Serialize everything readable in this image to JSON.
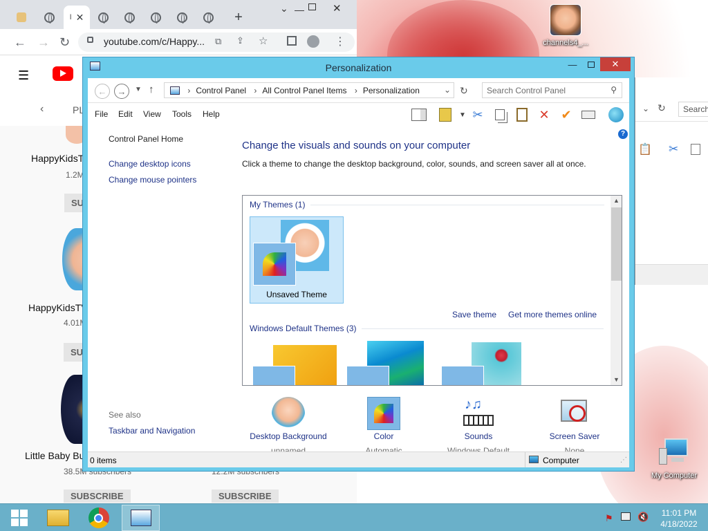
{
  "desktop": {
    "icons": [
      {
        "label": "channels4_...",
        "icon": "baby-photo-icon"
      },
      {
        "label": "My Computer",
        "icon": "computer-icon"
      }
    ]
  },
  "browser": {
    "url": "youtube.com/c/Happy...",
    "nav_label": "PL",
    "channels": [
      {
        "name": "HappyKidsT",
        "subs": "1.2M",
        "subscribe": "SU"
      },
      {
        "name": "HappyKidsTV",
        "subs": "4.01M",
        "subscribe": "SU"
      },
      {
        "name": "Little Baby Bu",
        "subs": "38.5M subscribers",
        "subscribe": "SUBSCRIBE"
      },
      {
        "name": "",
        "subs": "12.2M subscribers",
        "subscribe": "SUBSCRIBE"
      }
    ]
  },
  "explorer_behind": {
    "search_placeholder": "Search"
  },
  "window": {
    "title": "Personalization",
    "address": {
      "crumbs": [
        "Control Panel",
        "All Control Panel Items",
        "Personalization"
      ],
      "search_placeholder": "Search Control Panel"
    },
    "menu": [
      "File",
      "Edit",
      "View",
      "Tools",
      "Help"
    ],
    "left_nav": {
      "home": "Control Panel Home",
      "links": [
        "Change desktop icons",
        "Change mouse pointers"
      ],
      "see_also_title": "See also",
      "see_also_links": [
        "Taskbar and Navigation"
      ]
    },
    "main": {
      "heading": "Change the visuals and sounds on your computer",
      "description": "Click a theme to change the desktop background, color, sounds, and screen saver all at once.",
      "my_themes_title": "My Themes (1)",
      "unsaved_theme_label": "Unsaved Theme",
      "save_theme": "Save theme",
      "get_more_themes": "Get more themes online",
      "default_themes_title": "Windows Default Themes (3)"
    },
    "bottom_items": [
      {
        "label": "Desktop Background",
        "value": "unnamed",
        "icon": "baby-wallpaper-icon"
      },
      {
        "label": "Color",
        "value": "Automatic",
        "icon": "color-fan-icon"
      },
      {
        "label": "Sounds",
        "value": "Windows Default",
        "icon": "music-keyboard-icon"
      },
      {
        "label": "Screen Saver",
        "value": "None",
        "icon": "screen-saver-icon"
      }
    ],
    "status": {
      "items": "0 items",
      "location": "Computer"
    }
  },
  "taskbar": {
    "time": "11:01 PM",
    "date": "4/18/2022"
  },
  "colors": {
    "titlebar": "#6acbea",
    "link": "#1e3287",
    "close": "#c7403a",
    "taskbar": "#6ab0c9"
  }
}
